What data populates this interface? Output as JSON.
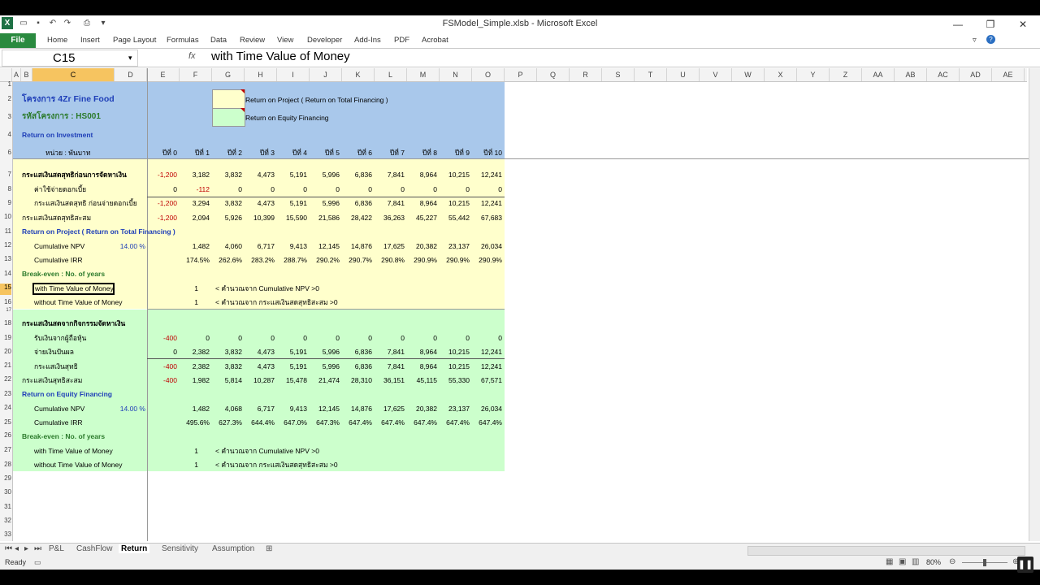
{
  "window": {
    "title": "FSModel_Simple.xlsb - Microsoft Excel",
    "app_icon": "X",
    "controls": {
      "min": "—",
      "max": "❐",
      "close": "✕"
    }
  },
  "ribbon": {
    "file": "File",
    "tabs": [
      "Home",
      "Insert",
      "Page Layout",
      "Formulas",
      "Data",
      "Review",
      "View",
      "Developer",
      "Add-Ins",
      "PDF",
      "Acrobat"
    ]
  },
  "formula_bar": {
    "name_box": "C15",
    "fx": "fx",
    "formula": "with Time Value of Money"
  },
  "columns": [
    "A",
    "B",
    "C",
    "D",
    "E",
    "F",
    "G",
    "H",
    "I",
    "J",
    "K",
    "L",
    "M",
    "N",
    "O",
    "P",
    "Q",
    "R",
    "S",
    "T",
    "U",
    "V",
    "W",
    "X",
    "Y",
    "Z",
    "AA",
    "AB",
    "AC",
    "AD",
    "AE"
  ],
  "rows": [
    "1",
    "2",
    "3",
    "4",
    "6",
    "7",
    "8",
    "9",
    "10",
    "11",
    "12",
    "13",
    "14",
    "15",
    "16",
    "17",
    "18",
    "19",
    "20",
    "21",
    "22",
    "23",
    "24",
    "25",
    "26",
    "27",
    "28",
    "29",
    "30",
    "31",
    "32",
    "33"
  ],
  "sheet": {
    "project_title": "โครงการ 4Zr Fine Food",
    "project_code": "รหัสโครงการ : HS001",
    "section": "Return on Investment",
    "unit": "หน่วย : พันบาท",
    "legend": {
      "project": "Return on Project ( Return on Total Financing )",
      "equity": "Return on Equity Financing"
    },
    "years": [
      "ปีที่ 0",
      "ปีที่ 1",
      "ปีที่ 2",
      "ปีที่ 3",
      "ปีที่ 4",
      "ปีที่ 5",
      "ปีที่ 6",
      "ปีที่ 7",
      "ปีที่ 8",
      "ปีที่ 9",
      "ปีที่ 10"
    ],
    "project_rows": [
      {
        "label": "กระแสเงินสดสุทธิก่อนการจัดหาเงิน",
        "values": [
          "-1,200",
          "3,182",
          "3,832",
          "4,473",
          "5,191",
          "5,996",
          "6,836",
          "7,841",
          "8,964",
          "10,215",
          "12,241"
        ]
      },
      {
        "label": "ค่าใช้จ่ายดอกเบี้ย",
        "values": [
          "0",
          "-112",
          "0",
          "0",
          "0",
          "0",
          "0",
          "0",
          "0",
          "0",
          "0"
        ]
      },
      {
        "label": "กระแสเงินสดสุทธิ ก่อนจ่ายดอกเบี้ย",
        "values": [
          "-1,200",
          "3,294",
          "3,832",
          "4,473",
          "5,191",
          "5,996",
          "6,836",
          "7,841",
          "8,964",
          "10,215",
          "12,241"
        ]
      },
      {
        "label": "กระแสเงินสดสุทธิสะสม",
        "values": [
          "-1,200",
          "2,094",
          "5,926",
          "10,399",
          "15,590",
          "21,586",
          "28,422",
          "36,263",
          "45,227",
          "55,442",
          "67,683"
        ]
      }
    ],
    "project_return": {
      "title": "Return on Project ( Return on Total Financing )",
      "npv_label": "Cumulative NPV",
      "npv_rate": "14.00 %",
      "npv_values": [
        "1,482",
        "4,060",
        "6,717",
        "9,413",
        "12,145",
        "14,876",
        "17,625",
        "20,382",
        "23,137",
        "26,034"
      ],
      "irr_label": "Cumulative IRR",
      "irr_values": [
        "174.5%",
        "262.6%",
        "283.2%",
        "288.7%",
        "290.2%",
        "290.7%",
        "290.8%",
        "290.9%",
        "290.9%",
        "290.9%"
      ],
      "breakeven_title": "Break-even : No. of years",
      "with_tvm": "with Time Value of Money",
      "with_tvm_value": "1",
      "with_tvm_note": "< คำนวณจาก Cumulative NPV >0",
      "without_tvm": "without Time Value of Money",
      "without_tvm_value": "1",
      "without_tvm_note": "< คำนวณจาก กระแสเงินสดสุทธิสะสม >0"
    },
    "financing_title": "กระแสเงินสดจากกิจกรรมจัดหาเงิน",
    "financing_rows": [
      {
        "label": "รับเงินจากผู้ถือหุ้น",
        "values": [
          "-400",
          "0",
          "0",
          "0",
          "0",
          "0",
          "0",
          "0",
          "0",
          "0",
          "0"
        ]
      },
      {
        "label": "จ่ายเงินปันผล",
        "values": [
          "0",
          "2,382",
          "3,832",
          "4,473",
          "5,191",
          "5,996",
          "6,836",
          "7,841",
          "8,964",
          "10,215",
          "12,241"
        ]
      },
      {
        "label": "กระแสเงินสุทธิ",
        "values": [
          "-400",
          "2,382",
          "3,832",
          "4,473",
          "5,191",
          "5,996",
          "6,836",
          "7,841",
          "8,964",
          "10,215",
          "12,241"
        ]
      },
      {
        "label": "กระแสเงินสุทธิสะสม",
        "values": [
          "-400",
          "1,982",
          "5,814",
          "10,287",
          "15,478",
          "21,474",
          "28,310",
          "36,151",
          "45,115",
          "55,330",
          "67,571"
        ]
      }
    ],
    "equity_return": {
      "title": "Return on Equity Financing",
      "npv_label": "Cumulative NPV",
      "npv_rate": "14.00 %",
      "npv_values": [
        "1,482",
        "4,068",
        "6,717",
        "9,413",
        "12,145",
        "14,876",
        "17,625",
        "20,382",
        "23,137",
        "26,034"
      ],
      "irr_label": "Cumulative IRR",
      "irr_values": [
        "495.6%",
        "627.3%",
        "644.4%",
        "647.0%",
        "647.3%",
        "647.4%",
        "647.4%",
        "647.4%",
        "647.4%",
        "647.4%"
      ],
      "breakeven_title": "Break-even : No. of years",
      "with_tvm": "with Time Value of Money",
      "with_tvm_value": "1",
      "with_tvm_note": "< คำนวณจาก Cumulative NPV >0",
      "without_tvm": "without Time Value of Money",
      "without_tvm_value": "1",
      "without_tvm_note": "< คำนวณจาก กระแสเงินสดสุทธิสะสม >0"
    }
  },
  "sheet_tabs": [
    "P&L",
    "CashFlow",
    "Return",
    "Sensitivity",
    "Assumption"
  ],
  "active_sheet": "Return",
  "status": {
    "ready": "Ready",
    "zoom": "80%"
  },
  "colors": {
    "yellow_fill": "#ffffcc",
    "green_fill": "#ccffcc",
    "blue_header": "#a9c8eb",
    "excel_green": "#2a8a3f"
  }
}
